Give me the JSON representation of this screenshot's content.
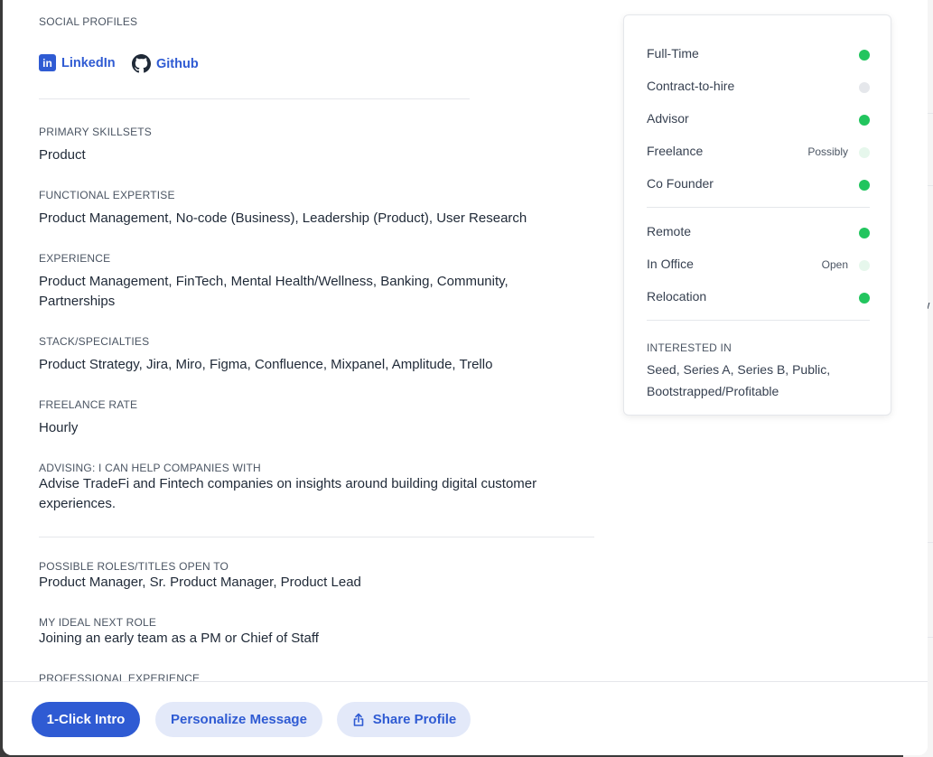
{
  "social": {
    "heading": "SOCIAL PROFILES",
    "links": [
      {
        "label": "LinkedIn",
        "icon": "linkedin-icon"
      },
      {
        "label": "Github",
        "icon": "github-icon"
      }
    ]
  },
  "sections": [
    {
      "label": "PRIMARY SKILLSETS",
      "value": "Product"
    },
    {
      "label": "FUNCTIONAL EXPERTISE",
      "value": "Product Management, No-code (Business), Leadership (Product), User Research"
    },
    {
      "label": "EXPERIENCE",
      "value": "Product Management, FinTech, Mental Health/Wellness, Banking, Community, Partnerships"
    },
    {
      "label": "STACK/SPECIALTIES",
      "value": "Product Strategy, Jira, Miro, Figma, Confluence, Mixpanel, Amplitude, Trello"
    },
    {
      "label": "FREELANCE RATE",
      "value": "Hourly"
    },
    {
      "label": "ADVISING: I CAN HELP COMPANIES WITH",
      "value": "Advise TradeFi and Fintech companies on insights around building digital customer experiences."
    },
    {
      "label": "POSSIBLE ROLES/TITLES OPEN TO",
      "value": "Product Manager, Sr. Product Manager, Product Lead"
    },
    {
      "label": "MY IDEAL NEXT ROLE",
      "value": "Joining an early team as a PM or Chief of Staff"
    },
    {
      "label": "PROFESSIONAL EXPERIENCE",
      "value": ""
    }
  ],
  "availability": {
    "employment": [
      {
        "label": "Full-Time",
        "status": "",
        "color": "#22c55e"
      },
      {
        "label": "Contract-to-hire",
        "status": "",
        "color": "#e5e7eb"
      },
      {
        "label": "Advisor",
        "status": "",
        "color": "#22c55e"
      },
      {
        "label": "Freelance",
        "status": "Possibly",
        "color": "#e6f7ec"
      },
      {
        "label": "Co Founder",
        "status": "",
        "color": "#22c55e"
      }
    ],
    "location": [
      {
        "label": "Remote",
        "status": "",
        "color": "#22c55e"
      },
      {
        "label": "In Office",
        "status": "Open",
        "color": "#e6f7ec"
      },
      {
        "label": "Relocation",
        "status": "",
        "color": "#22c55e"
      }
    ],
    "interested_heading": "INTERESTED IN",
    "interested_value": "Seed, Series A, Series B, Public, Bootstrapped/Profitable"
  },
  "footer": {
    "intro_button": "1-Click Intro",
    "personalize_button": "Personalize Message",
    "share_button": "Share Profile",
    "share_icon": "share-icon"
  },
  "colors": {
    "accent": "#2f5bd3",
    "accent_light": "#e3e9f9",
    "status_green": "#22c55e"
  }
}
